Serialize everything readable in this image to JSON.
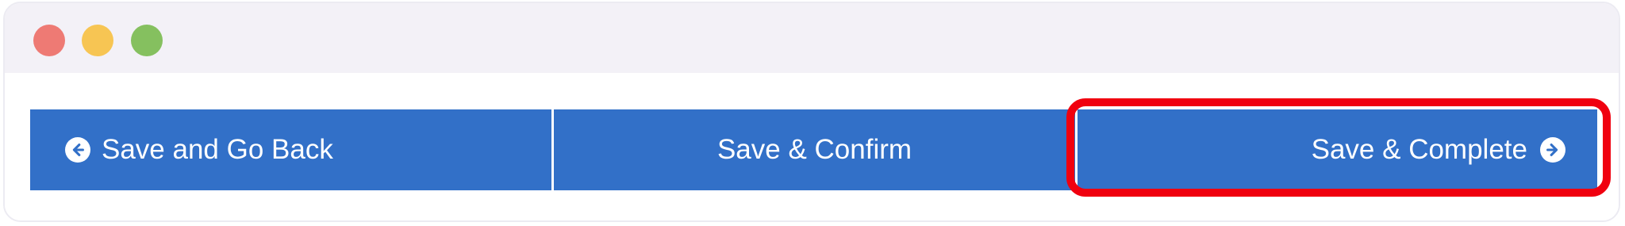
{
  "window": {
    "controls": [
      "close",
      "minimize",
      "maximize"
    ]
  },
  "buttons": {
    "back_label": "Save and Go Back",
    "back_icon": "arrow-left-circle-icon",
    "confirm_label": "Save & Confirm",
    "complete_label": "Save & Complete",
    "complete_icon": "arrow-right-circle-icon"
  },
  "colors": {
    "button_bg": "#3270c8",
    "highlight": "#f0000f"
  }
}
